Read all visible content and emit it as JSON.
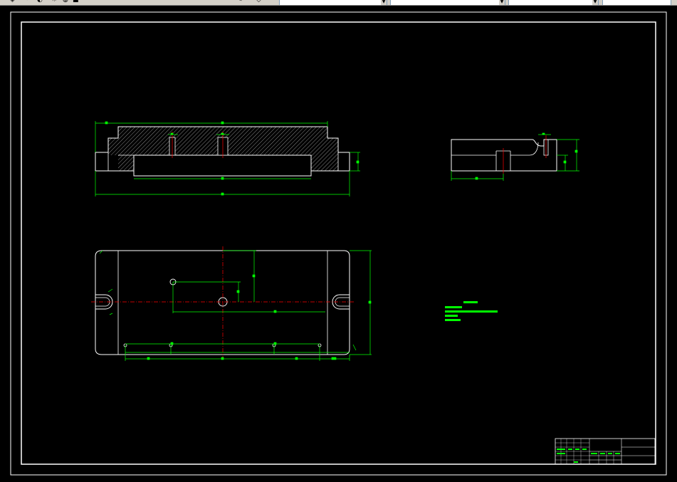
{
  "window": {
    "toolbar": {
      "layer_combo": {
        "value": ""
      },
      "linetype_combo": {
        "value": ""
      },
      "lineweight_combo": {
        "value": ""
      },
      "plotstyle_combo": {
        "value": ""
      },
      "status_text": "",
      "corner_text": ""
    }
  },
  "drawing": {
    "colors": {
      "background": "#000000",
      "frame": "#ffffff",
      "dimension": "#00ff00",
      "centerline": "#ff0000",
      "hatch": "#c0c0c0",
      "note": "#00ff00"
    },
    "tech_note": {
      "title": "",
      "lines": [
        "",
        "",
        "",
        ""
      ]
    },
    "title_block": {
      "drawing_name": "",
      "drawing_number": "",
      "scale": "",
      "material": ""
    }
  }
}
